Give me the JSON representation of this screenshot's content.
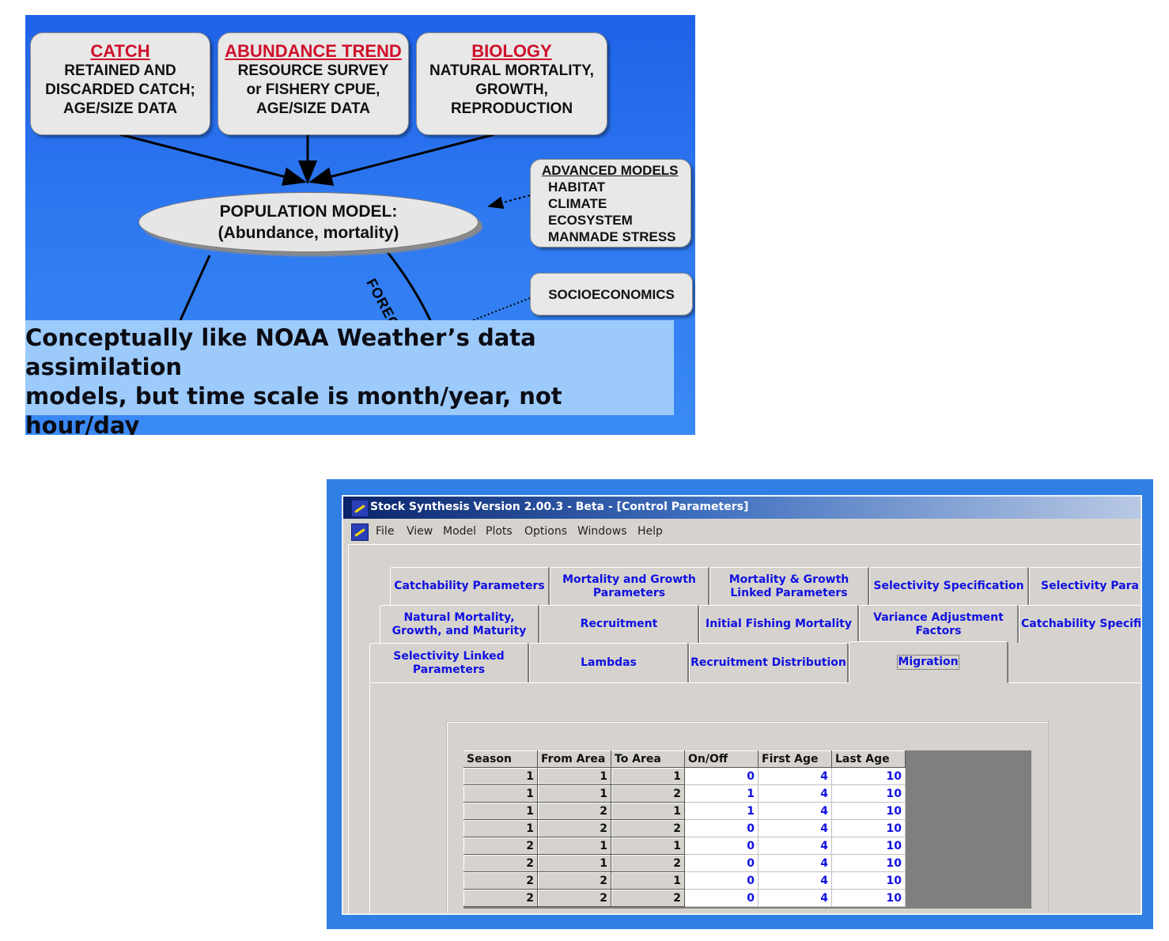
{
  "diagram": {
    "catch": {
      "header": "CATCH",
      "lines": [
        "RETAINED AND",
        "DISCARDED CATCH;",
        "AGE/SIZE DATA"
      ]
    },
    "abundance": {
      "header": "ABUNDANCE TREND",
      "lines": [
        "RESOURCE SURVEY",
        "or FISHERY CPUE,",
        "AGE/SIZE DATA"
      ]
    },
    "biology": {
      "header": "BIOLOGY",
      "lines": [
        "NATURAL MORTALITY,",
        "GROWTH,",
        "REPRODUCTION"
      ]
    },
    "advanced": {
      "header": "ADVANCED MODELS",
      "lines": [
        "HABITAT",
        "CLIMATE",
        "ECOSYSTEM",
        "MANMADE STRESS"
      ]
    },
    "socio": {
      "label": "SOCIOECONOMICS"
    },
    "population": {
      "line1": "POPULATION MODEL:",
      "line2": "(Abundance, mortality)"
    },
    "forecast_label": "FORECAS",
    "caption": [
      "Conceptually like NOAA Weather’s data assimilation",
      "models, but time scale is month/year, not hour/day"
    ],
    "colors": {
      "background": "#2a6ef0",
      "header_red": "#d0102a",
      "caption_bg": "#9ccbfb"
    }
  },
  "window": {
    "title": "Stock Synthesis Version 2.00.3 - Beta - [Control Parameters]",
    "menu": [
      "File",
      "View",
      "Model",
      "Plots",
      "Options",
      "Windows",
      "Help"
    ],
    "tab_rows": [
      [
        "Catchability Parameters",
        "Mortality and Growth Parameters",
        "Mortality & Growth Linked Parameters",
        "Selectivity Specification",
        "Selectivity Para"
      ],
      [
        "Natural Mortality, Growth, and Maturity",
        "Recruitment",
        "Initial Fishing Mortality",
        "Variance Adjustment Factors",
        "Catchability Specifi"
      ],
      [
        "Selectivity Linked Parameters",
        "Lambdas",
        "Recruitment Distribution",
        "Migration"
      ]
    ],
    "active_tab": "Migration",
    "table": {
      "columns": [
        "Season",
        "From Area",
        "To Area",
        "On/Off",
        "First Age",
        "Last Age"
      ],
      "rows": [
        [
          1,
          1,
          1,
          0,
          4,
          10
        ],
        [
          1,
          1,
          2,
          1,
          4,
          10
        ],
        [
          1,
          2,
          1,
          1,
          4,
          10
        ],
        [
          1,
          2,
          2,
          0,
          4,
          10
        ],
        [
          2,
          1,
          1,
          0,
          4,
          10
        ],
        [
          2,
          1,
          2,
          0,
          4,
          10
        ],
        [
          2,
          2,
          1,
          0,
          4,
          10
        ],
        [
          2,
          2,
          2,
          0,
          4,
          10
        ]
      ]
    },
    "colors": {
      "title_bar": "#0a246a",
      "tab_text": "#1010e0",
      "editable_value": "#1010e0"
    }
  }
}
